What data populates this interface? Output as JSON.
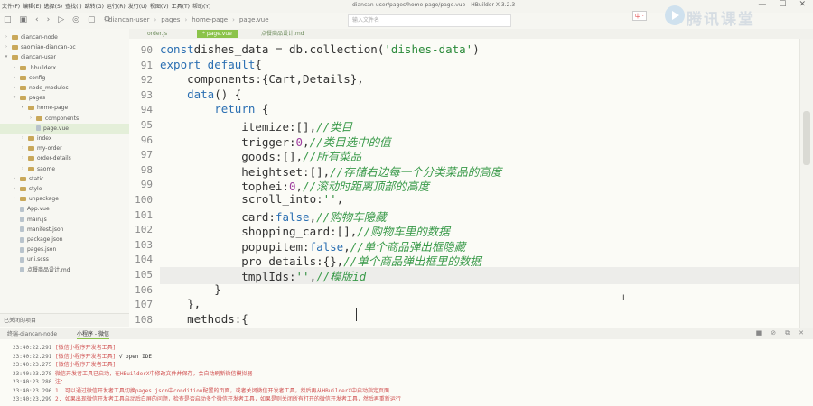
{
  "window": {
    "title": "diancan-user/pages/home-page/page.vue - HBuilder X 3.2.3",
    "menu": [
      "文件(F)",
      "编辑(E)",
      "选择(S)",
      "查找(I)",
      "跳转(G)",
      "运行(R)",
      "发行(U)",
      "视图(V)",
      "工具(T)",
      "帮助(Y)"
    ],
    "controls": [
      "—",
      "☐",
      "✕"
    ]
  },
  "toolbar": {
    "breadcrumb": [
      "diancan-user",
      "pages",
      "home-page",
      "page.vue"
    ],
    "search_placeholder": "输入文件名",
    "brand": "腾讯课堂",
    "ime": "中 ·"
  },
  "sidebar": {
    "items": [
      {
        "label": "diancan-node",
        "depth": 0,
        "kind": "folder",
        "expanded": false
      },
      {
        "label": "saomiao-diancan-pc",
        "depth": 0,
        "kind": "folder",
        "expanded": false
      },
      {
        "label": "diancan-user",
        "depth": 0,
        "kind": "folder",
        "expanded": true
      },
      {
        "label": ".hbuilderx",
        "depth": 1,
        "kind": "folder",
        "expanded": false
      },
      {
        "label": "config",
        "depth": 1,
        "kind": "folder",
        "expanded": false
      },
      {
        "label": "node_modules",
        "depth": 1,
        "kind": "folder",
        "expanded": false
      },
      {
        "label": "pages",
        "depth": 1,
        "kind": "folder",
        "expanded": true
      },
      {
        "label": "home-page",
        "depth": 2,
        "kind": "folder",
        "expanded": true
      },
      {
        "label": "components",
        "depth": 3,
        "kind": "folder",
        "expanded": false
      },
      {
        "label": "page.vue",
        "depth": 3,
        "kind": "file",
        "selected": true
      },
      {
        "label": "index",
        "depth": 2,
        "kind": "folder",
        "expanded": false
      },
      {
        "label": "my-order",
        "depth": 2,
        "kind": "folder",
        "expanded": false
      },
      {
        "label": "order-details",
        "depth": 2,
        "kind": "folder",
        "expanded": false
      },
      {
        "label": "saome",
        "depth": 2,
        "kind": "folder",
        "expanded": false
      },
      {
        "label": "static",
        "depth": 1,
        "kind": "folder",
        "expanded": false
      },
      {
        "label": "style",
        "depth": 1,
        "kind": "folder",
        "expanded": false
      },
      {
        "label": "unpackage",
        "depth": 1,
        "kind": "folder",
        "expanded": false
      },
      {
        "label": "App.vue",
        "depth": 1,
        "kind": "file"
      },
      {
        "label": "main.js",
        "depth": 1,
        "kind": "file"
      },
      {
        "label": "manifest.json",
        "depth": 1,
        "kind": "file"
      },
      {
        "label": "package.json",
        "depth": 1,
        "kind": "file"
      },
      {
        "label": "pages.json",
        "depth": 1,
        "kind": "file"
      },
      {
        "label": "uni.scss",
        "depth": 1,
        "kind": "file"
      },
      {
        "label": "点餐商品设计.md",
        "depth": 1,
        "kind": "file"
      }
    ],
    "footer": "已关闭的项目"
  },
  "tabs": [
    {
      "label": "order.js",
      "active": false
    },
    {
      "label": "* page.vue",
      "active": true
    },
    {
      "label": "点餐商品设计.md",
      "active": false
    }
  ],
  "editor": {
    "lines": [
      {
        "n": "90",
        "tokens": [
          [
            "kw",
            "const"
          ],
          [
            "",
            "dishes_data = db.collection("
          ],
          [
            "str",
            "'dishes-data'"
          ],
          [
            "",
            ")"
          ]
        ]
      },
      {
        "n": "91",
        "tokens": [
          [
            "kw",
            "export default"
          ],
          [
            "",
            "{"
          ]
        ]
      },
      {
        "n": "92",
        "tokens": [
          [
            "",
            "    components:{Cart,Details},"
          ]
        ]
      },
      {
        "n": "93",
        "tokens": [
          [
            "",
            "    "
          ],
          [
            "kw",
            "data"
          ],
          [
            "",
            "() {"
          ]
        ]
      },
      {
        "n": "94",
        "tokens": [
          [
            "",
            "        "
          ],
          [
            "kw",
            "return"
          ],
          [
            "",
            " {"
          ]
        ]
      },
      {
        "n": "95",
        "tokens": [
          [
            "",
            "            itemize:[],"
          ],
          [
            "cm",
            "//类目"
          ]
        ]
      },
      {
        "n": "96",
        "tokens": [
          [
            "",
            "            trigger:"
          ],
          [
            "num",
            "0"
          ],
          [
            "",
            ","
          ],
          [
            "cm",
            "//类目选中的值"
          ]
        ]
      },
      {
        "n": "97",
        "tokens": [
          [
            "",
            "            goods:[],"
          ],
          [
            "cm",
            "//所有菜品"
          ]
        ]
      },
      {
        "n": "98",
        "tokens": [
          [
            "",
            "            heightset:[],"
          ],
          [
            "cm",
            "//存储右边每一个分类菜品的高度"
          ]
        ]
      },
      {
        "n": "99",
        "tokens": [
          [
            "",
            "            tophei:"
          ],
          [
            "num",
            "0"
          ],
          [
            "",
            ","
          ],
          [
            "cm",
            "//滚动时距离顶部的高度"
          ]
        ]
      },
      {
        "n": "100",
        "tokens": [
          [
            "",
            "            scroll_into:"
          ],
          [
            "str",
            "''"
          ],
          [
            "",
            ","
          ]
        ]
      },
      {
        "n": "101",
        "tokens": [
          [
            "",
            "            card:"
          ],
          [
            "kw",
            "false"
          ],
          [
            "",
            ","
          ],
          [
            "cm",
            "//购物车隐藏"
          ]
        ]
      },
      {
        "n": "102",
        "tokens": [
          [
            "",
            "            shopping_card:[],"
          ],
          [
            "cm",
            "//购物车里的数据"
          ]
        ]
      },
      {
        "n": "103",
        "tokens": [
          [
            "",
            "            popupitem:"
          ],
          [
            "kw",
            "false"
          ],
          [
            "",
            ","
          ],
          [
            "cm",
            "//单个商品弹出框隐藏"
          ]
        ]
      },
      {
        "n": "104",
        "tokens": [
          [
            "",
            "            pro_details:{},"
          ],
          [
            "cm",
            "//单个商品弹出框里的数据"
          ]
        ]
      },
      {
        "n": "105",
        "tokens": [
          [
            "",
            "            tmplIds:"
          ],
          [
            "str",
            "''"
          ],
          [
            "",
            ","
          ],
          [
            "cm",
            "//模版id"
          ]
        ],
        "current": true
      },
      {
        "n": "106",
        "tokens": [
          [
            "",
            "        }"
          ]
        ]
      },
      {
        "n": "107",
        "tokens": [
          [
            "",
            "    },"
          ]
        ]
      },
      {
        "n": "108",
        "tokens": [
          [
            "",
            "    methods:{"
          ]
        ]
      }
    ]
  },
  "console": {
    "tabs": [
      {
        "label": "终端-diancan-node",
        "active": false
      },
      {
        "label": "小程序 - 微信",
        "active": true
      }
    ],
    "logs": [
      {
        "ts": "23:40:22.291",
        "msg": "[微信小程序开发者工具]",
        "tail": ""
      },
      {
        "ts": "23:40:22.291",
        "msg": "[微信小程序开发者工具]",
        "tail": " √ open IDE"
      },
      {
        "ts": "23:40:23.275",
        "msg": "[微信小程序开发者工具]",
        "tail": ""
      },
      {
        "ts": "23:40:23.278",
        "msg": "",
        "tail": "微信开发者工具已启动，在HBuilderX中修改文件并保存，会自动刷新微信模拟器"
      },
      {
        "ts": "23:40:23.280",
        "msg": "",
        "tail": "注："
      },
      {
        "ts": "23:40:23.296",
        "msg": "",
        "tail": "1. 可以通过微信开发者工具切换pages.json中condition配置的页面，或者关闭微信开发者工具，然后再从HBuilderX中启动指定页面"
      },
      {
        "ts": "23:40:23.299",
        "msg": "",
        "tail": "2. 如果出现微信开发者工具启动后白屏的问题，检查是否启动多个微信开发者工具，如果是则关闭所有打开的微信开发者工具，然后再重新运行"
      }
    ]
  }
}
